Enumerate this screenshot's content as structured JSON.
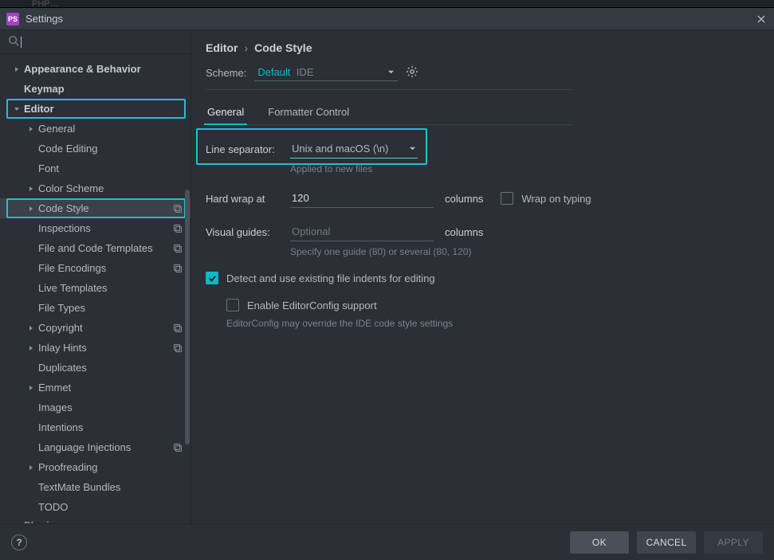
{
  "window": {
    "title": "Settings"
  },
  "breadcrumb": {
    "parent": "Editor",
    "current": "Code Style"
  },
  "scheme": {
    "label": "Scheme:",
    "value": "Default",
    "tag": "IDE"
  },
  "tabs": {
    "general": "General",
    "formatter": "Formatter Control"
  },
  "form": {
    "line_separator_label": "Line separator:",
    "line_separator_value": "Unix and macOS (\\n)",
    "line_separator_hint": "Applied to new files",
    "hard_wrap_label": "Hard wrap at",
    "hard_wrap_value": "120",
    "columns": "columns",
    "wrap_on_typing": "Wrap on typing",
    "visual_guides_label": "Visual guides:",
    "visual_guides_placeholder": "Optional",
    "visual_guides_hint": "Specify one guide (80) or several (80, 120)",
    "detect_indents": "Detect and use existing file indents for editing",
    "enable_editorconfig": "Enable EditorConfig support",
    "editorconfig_hint": "EditorConfig may override the IDE code style settings"
  },
  "footer": {
    "ok": "OK",
    "cancel": "CANCEL",
    "apply": "APPLY"
  },
  "tree": [
    {
      "label": "Appearance & Behavior",
      "depth": 0,
      "arrow": "right",
      "bold": true
    },
    {
      "label": "Keymap",
      "depth": 0,
      "bold": true
    },
    {
      "label": "Editor",
      "depth": 0,
      "arrow": "down",
      "bold": true,
      "outline": true
    },
    {
      "label": "General",
      "depth": 1,
      "arrow": "right"
    },
    {
      "label": "Code Editing",
      "depth": 1
    },
    {
      "label": "Font",
      "depth": 1
    },
    {
      "label": "Color Scheme",
      "depth": 1,
      "arrow": "right"
    },
    {
      "label": "Code Style",
      "depth": 1,
      "arrow": "right",
      "selected": true,
      "outline": true,
      "badge": true
    },
    {
      "label": "Inspections",
      "depth": 1,
      "badge": true
    },
    {
      "label": "File and Code Templates",
      "depth": 1,
      "badge": true
    },
    {
      "label": "File Encodings",
      "depth": 1,
      "badge": true
    },
    {
      "label": "Live Templates",
      "depth": 1
    },
    {
      "label": "File Types",
      "depth": 1
    },
    {
      "label": "Copyright",
      "depth": 1,
      "arrow": "right",
      "badge": true
    },
    {
      "label": "Inlay Hints",
      "depth": 1,
      "arrow": "right",
      "badge": true
    },
    {
      "label": "Duplicates",
      "depth": 1
    },
    {
      "label": "Emmet",
      "depth": 1,
      "arrow": "right"
    },
    {
      "label": "Images",
      "depth": 1
    },
    {
      "label": "Intentions",
      "depth": 1
    },
    {
      "label": "Language Injections",
      "depth": 1,
      "badge": true
    },
    {
      "label": "Proofreading",
      "depth": 1,
      "arrow": "right"
    },
    {
      "label": "TextMate Bundles",
      "depth": 1
    },
    {
      "label": "TODO",
      "depth": 1
    },
    {
      "label": "Plugins",
      "depth": 0,
      "bold": true,
      "cut": true
    }
  ]
}
